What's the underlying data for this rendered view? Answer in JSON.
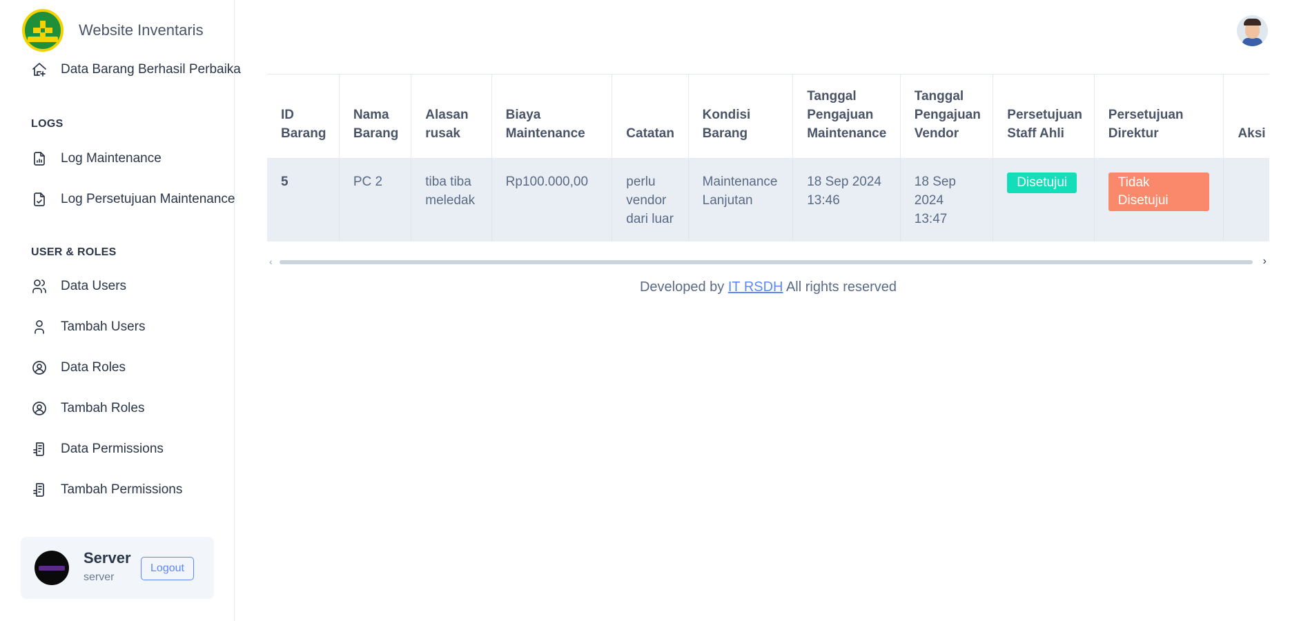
{
  "brand": {
    "title": "Website Inventaris"
  },
  "sidebar": {
    "top_item": {
      "label": "Data Barang Berhasil Perbaika",
      "icon": "home-plus-icon"
    },
    "sections": [
      {
        "caption": "LOGS"
      },
      {
        "caption": "USER & ROLES"
      }
    ],
    "logs": [
      {
        "label": "Log Maintenance",
        "icon": "file-chart-icon"
      },
      {
        "label": "Log Persetujuan Maintenance",
        "icon": "file-check-icon"
      }
    ],
    "users": [
      {
        "label": "Data Users",
        "icon": "users-icon"
      },
      {
        "label": "Tambah Users",
        "icon": "user-icon"
      },
      {
        "label": "Data Roles",
        "icon": "user-circle-icon"
      },
      {
        "label": "Tambah Roles",
        "icon": "user-circle-icon"
      },
      {
        "label": "Data Permissions",
        "icon": "report-icon"
      },
      {
        "label": "Tambah Permissions",
        "icon": "report-icon"
      }
    ],
    "user_card": {
      "name": "Server",
      "role": "server",
      "logout": "Logout"
    }
  },
  "table": {
    "headers": [
      "ID Barang",
      "Nama Barang",
      "Alasan rusak",
      "Biaya Maintenance",
      "Catatan",
      "Kondisi Barang",
      "Tanggal Pengajuan Maintenance",
      "Tanggal Pengajuan Vendor",
      "Persetujuan Staff Ahli",
      "Persetujuan Direktur",
      "Aksi"
    ],
    "rows": [
      {
        "id": "5",
        "nama": "PC 2",
        "alasan": "tiba tiba meledak",
        "biaya": "Rp100.000,00",
        "catatan": "perlu vendor dari luar",
        "kondisi": "Maintenance Lanjutan",
        "tgl_maintenance": "18 Sep 2024 13:46",
        "tgl_vendor": "18 Sep 2024 13:47",
        "staff_ahli": "Disetujui",
        "direktur": "Tidak Disetujui",
        "aksi": ""
      }
    ]
  },
  "footer": {
    "prefix": "Developed by",
    "link": "IT RSDH",
    "suffix": "All rights reserved"
  },
  "colors": {
    "accent": "#5d87ff",
    "success": "#13deb9",
    "danger": "#fa896b",
    "row_bg": "#e8eef3"
  }
}
